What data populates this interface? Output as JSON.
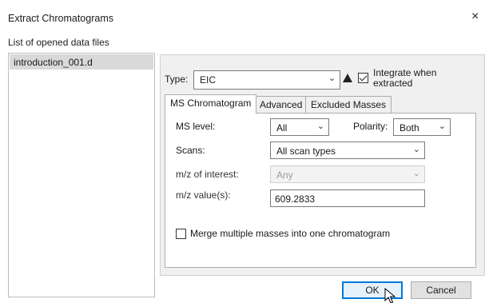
{
  "window": {
    "title": "Extract Chromatograms",
    "close_glyph": "×"
  },
  "files": {
    "label": "List of opened data files",
    "items": [
      "introduction_001.d"
    ]
  },
  "type_row": {
    "label": "Type:",
    "value": "EIC",
    "integrate_label": "Integrate when extracted",
    "integrate_checked": true
  },
  "tabs": [
    {
      "label": "MS Chromatogram",
      "active": true
    },
    {
      "label": "Advanced",
      "active": false
    },
    {
      "label": "Excluded Masses",
      "active": false
    }
  ],
  "ms_tab": {
    "ms_level_label": "MS level:",
    "ms_level_value": "All",
    "polarity_label": "Polarity:",
    "polarity_value": "Both",
    "scans_label": "Scans:",
    "scans_value": "All scan types",
    "mz_interest_label": "m/z of interest:",
    "mz_interest_value": "Any",
    "mz_values_label": "m/z value(s):",
    "mz_values_value": "609.2833",
    "merge_label": "Merge multiple masses into one chromatogram",
    "merge_checked": false
  },
  "buttons": {
    "ok": "OK",
    "cancel": "Cancel"
  },
  "icons": {
    "chevron": "chevron-down-icon",
    "warning": "warning-icon",
    "cursor": "mouse-pointer-icon"
  }
}
